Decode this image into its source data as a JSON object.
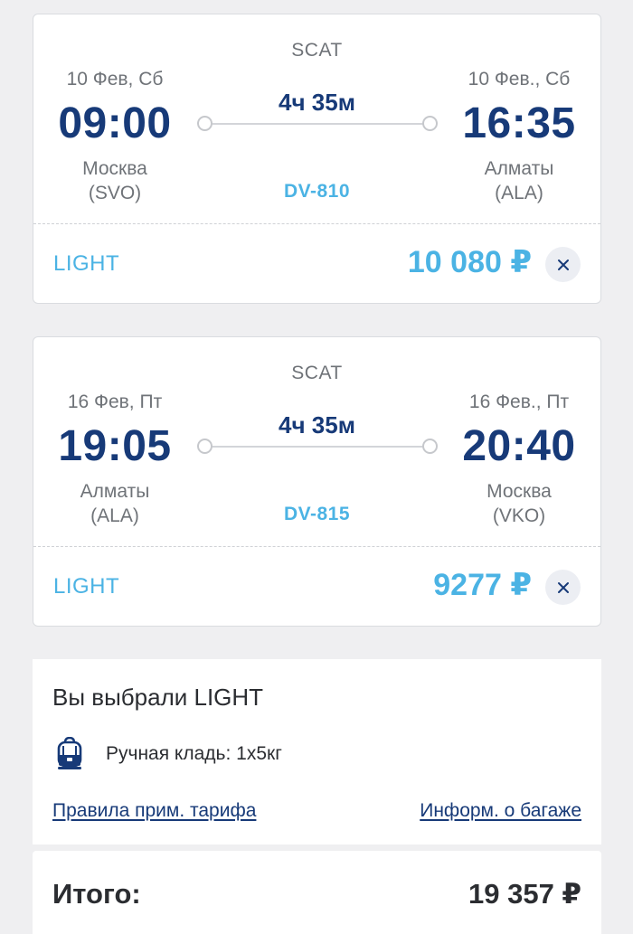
{
  "flights": [
    {
      "carrier": "SCAT",
      "departure": {
        "date": "10 Фев, Сб",
        "time": "09:00",
        "city": "Москва",
        "code": "(SVO)"
      },
      "arrival": {
        "date": "10 Фев., Сб",
        "time": "16:35",
        "city": "Алматы",
        "code": "(ALA)"
      },
      "duration": "4ч 35м",
      "flight_number": "DV-810",
      "tariff": "LIGHT",
      "price": "10 080 ₽"
    },
    {
      "carrier": "SCAT",
      "departure": {
        "date": "16 Фев, Пт",
        "time": "19:05",
        "city": "Алматы",
        "code": "(ALA)"
      },
      "arrival": {
        "date": "16 Фев., Пт",
        "time": "20:40",
        "city": "Москва",
        "code": "(VKO)"
      },
      "duration": "4ч 35м",
      "flight_number": "DV-815",
      "tariff": "LIGHT",
      "price": "9277 ₽"
    }
  ],
  "selected_tariff": {
    "title": "Вы выбрали LIGHT",
    "baggage_icon": "carry-on-bag-icon",
    "baggage_text": "Ручная кладь: 1x5кг",
    "fare_rules_link": "Правила прим. тарифа",
    "baggage_info_link": "Информ. о багаже"
  },
  "total": {
    "label": "Итого:",
    "value": "19 357 ₽"
  },
  "colors": {
    "navy": "#173a78",
    "accent": "#4bb3e4",
    "background": "#efeff1"
  }
}
